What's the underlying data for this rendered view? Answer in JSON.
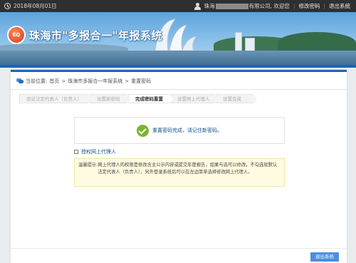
{
  "topbar": {
    "date": "2018年08月01日",
    "user_prefix": "珠海",
    "user_suffix": "有限公司, 欢迎您",
    "change_password": "修改密码",
    "logout": "退出系统",
    "separator": "|"
  },
  "banner": {
    "title": "珠海市\"多报合一\"年报系统"
  },
  "breadcrumb": {
    "label": "当前位置:",
    "home": "首页",
    "sep": ">",
    "system": "珠海市多报合一年报系统",
    "current": "重置密码"
  },
  "steps": [
    {
      "label": "验证法定代表人（负责人）",
      "active": false
    },
    {
      "label": "设置新密码",
      "active": false
    },
    {
      "label": "完成密码重置",
      "active": true
    },
    {
      "label": "设置网上代理人",
      "active": false
    },
    {
      "label": "设置完成",
      "active": false
    }
  ],
  "success": {
    "message": "重置密码完成，请记住新密码。"
  },
  "agent": {
    "label": "授权网上代理人",
    "checked": false
  },
  "tip": {
    "label": "温馨提示:",
    "text": "网上代理人的权限是修改含主公示内容或提交年度报告，如果与选可以修改，不勾选就默认法定代表人（负责人），另外登录系统后可以在左边菜单选择修改网上代理人。"
  },
  "actions": {
    "logout_button": "退出系统"
  },
  "colors": {
    "accent": "#1d63b8",
    "button": "#4a8fe0",
    "success": "#7ab52d",
    "tip_bg": "#fffbe0"
  }
}
